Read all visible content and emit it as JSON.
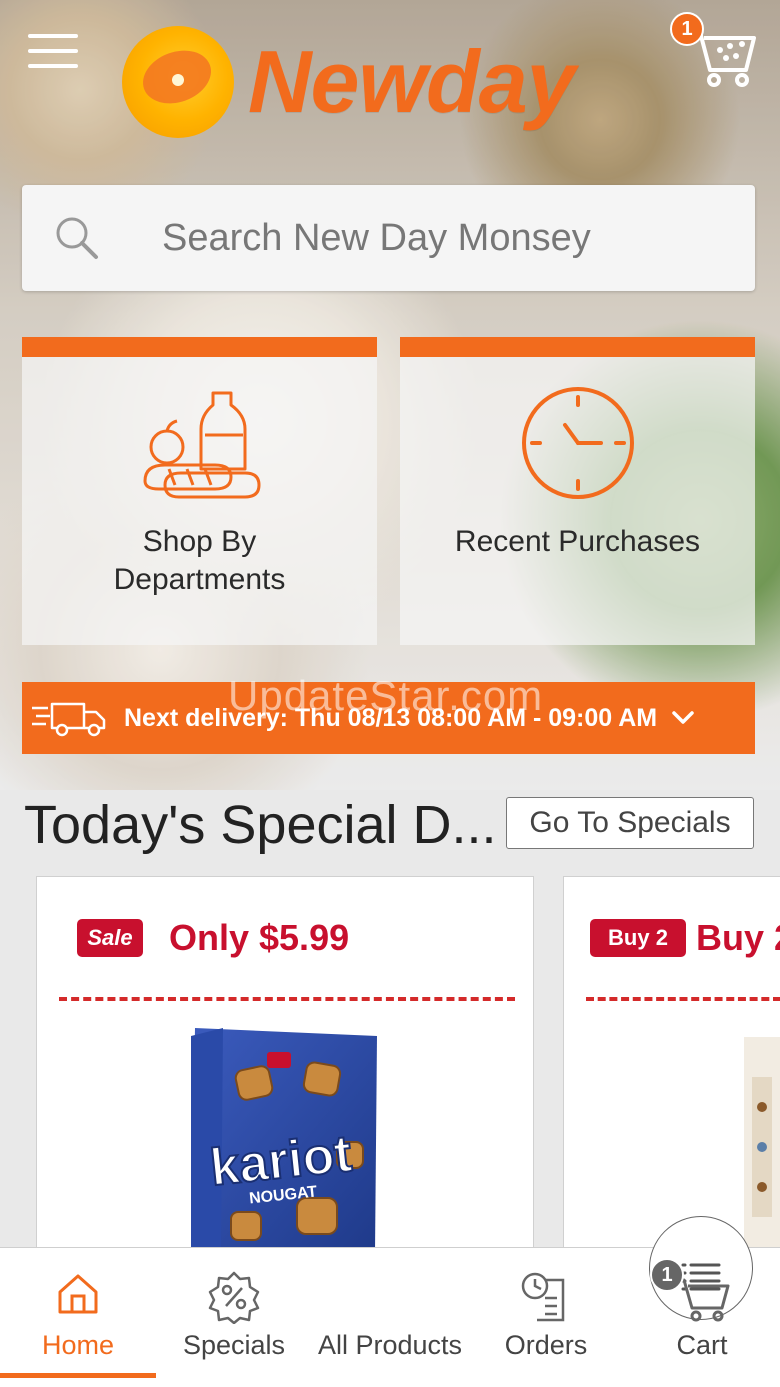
{
  "header": {
    "brand": "Newday",
    "cart_count": "1"
  },
  "search": {
    "placeholder": "Search New Day Monsey"
  },
  "tiles": [
    {
      "label": "Shop By Departments"
    },
    {
      "label": "Recent Purchases"
    }
  ],
  "delivery": {
    "text": "Next delivery: Thu 08/13 08:00 AM - 09:00 AM"
  },
  "watermark": "UpdateStar.com",
  "specials": {
    "title": "Today's Special D...",
    "button": "Go To Specials",
    "cards": [
      {
        "badge": "Sale",
        "promo": "Only $5.99",
        "product_brand": "kariot",
        "product_sub": "NOUGAT"
      },
      {
        "badge": "Buy 2",
        "promo": "Buy 2"
      }
    ]
  },
  "bottom_nav": {
    "items": [
      {
        "label": "Home",
        "icon": "home-icon"
      },
      {
        "label": "Specials",
        "icon": "percent-badge-icon"
      },
      {
        "label": "All Products",
        "icon": "list-icon"
      },
      {
        "label": "Orders",
        "icon": "orders-clock-icon"
      },
      {
        "label": "Cart",
        "icon": "cart-icon"
      }
    ],
    "cart_count": "1"
  },
  "colors": {
    "accent": "#f26b1d",
    "sale_red": "#c8102e"
  }
}
